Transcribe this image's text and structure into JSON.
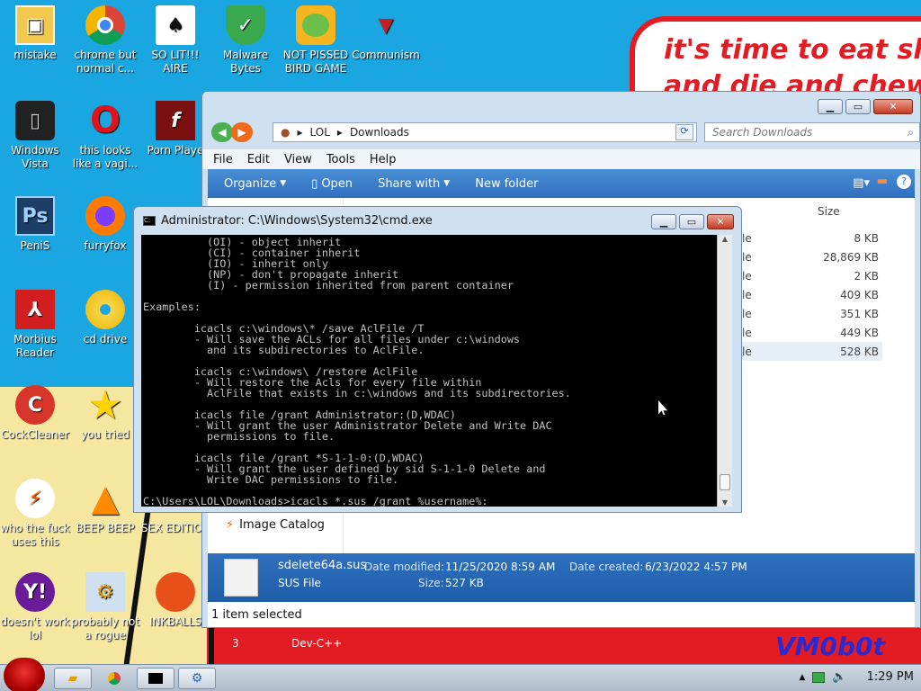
{
  "wallpaper": {
    "bubble_line1": "it's time to eat shit",
    "bubble_line2": "and die and chew",
    "signature": "VM0b0t"
  },
  "desktop_icons": [
    {
      "label": "mistake",
      "icon": "photo-frame-icon"
    },
    {
      "label": "chrome but normal c...",
      "icon": "chrome-icon"
    },
    {
      "label": "SO LIT!!! AIRE",
      "icon": "solitaire-icon"
    },
    {
      "label": "Malware Bytes",
      "icon": "shield-check-icon"
    },
    {
      "label": "NOT PISSED BIRD GAME",
      "icon": "green-pig-icon"
    },
    {
      "label": "Communism",
      "icon": "emblem-icon"
    },
    {
      "label": "Windows Vista",
      "icon": "recycle-bin-icon"
    },
    {
      "label": "this looks like a vagi...",
      "icon": "opera-icon"
    },
    {
      "label": "Porn Playe",
      "icon": "flash-icon"
    },
    {
      "label": "PeniS",
      "icon": "photoshop-icon"
    },
    {
      "label": "furryfox",
      "icon": "firefox-icon"
    },
    {
      "label": "Morbius Reader",
      "icon": "pdf-reader-icon"
    },
    {
      "label": "cd drive",
      "icon": "cd-drive-icon"
    },
    {
      "label": "CockCleaner",
      "icon": "ccleaner-icon"
    },
    {
      "label": "you tried",
      "icon": "star-icon"
    },
    {
      "label": "who the fuck uses this",
      "icon": "lightning-icon"
    },
    {
      "label": "BEEP BEEP",
      "icon": "vlc-cone-icon"
    },
    {
      "label": "SEX EDITIOR",
      "icon": "paint-icon"
    },
    {
      "label": "doesn't work lol",
      "icon": "yahoo-icon"
    },
    {
      "label": "probably not a rogue",
      "icon": "settings-monitor-icon"
    },
    {
      "label": "INKBALLS",
      "icon": "inkball-icon"
    }
  ],
  "partial_labels": {
    "behind_left": "3",
    "behind_right": "Dev-C++"
  },
  "explorer": {
    "breadcrumb": [
      "LOL",
      "Downloads"
    ],
    "search_placeholder": "Search Downloads",
    "menu": [
      "File",
      "Edit",
      "View",
      "Tools",
      "Help"
    ],
    "commands": [
      "Organize",
      "Open",
      "Share with",
      "New folder"
    ],
    "column_size": "Size",
    "rows": [
      {
        "type": "le",
        "size": "8 KB"
      },
      {
        "type": "le",
        "size": "28,869 KB"
      },
      {
        "type": "le",
        "size": "2 KB"
      },
      {
        "type": "le",
        "size": "409 KB"
      },
      {
        "type": "le",
        "size": "351 KB"
      },
      {
        "type": "le",
        "size": "449 KB"
      },
      {
        "type": "le",
        "size": "528 KB"
      }
    ],
    "sidebar_item": "Image Catalog",
    "details": {
      "filename": "sdelete64a.sus",
      "filetype": "SUS File",
      "modified_label": "Date modified:",
      "modified_value": "11/25/2020 8:59 AM",
      "created_label": "Date created:",
      "created_value": "6/23/2022 4:57 PM",
      "size_label": "Size:",
      "size_value": "527 KB"
    },
    "status": "1 item selected"
  },
  "cmd": {
    "title": "Administrator: C:\\Windows\\System32\\cmd.exe",
    "lines": [
      "          (OI) - object inherit",
      "          (CI) - container inherit",
      "          (IO) - inherit only",
      "          (NP) - don't propagate inherit",
      "          (I) - permission inherited from parent container",
      "",
      "Examples:",
      "",
      "        icacls c:\\windows\\* /save AclFile /T",
      "        - Will save the ACLs for all files under c:\\windows",
      "          and its subdirectories to AclFile.",
      "",
      "        icacls c:\\windows\\ /restore AclFile",
      "        - Will restore the Acls for every file within",
      "          AclFile that exists in c:\\windows and its subdirectories.",
      "",
      "        icacls file /grant Administrator:(D,WDAC)",
      "        - Will grant the user Administrator Delete and Write DAC",
      "          permissions to file.",
      "",
      "        icacls file /grant *S-1-1-0:(D,WDAC)",
      "        - Will grant the user defined by sid S-1-1-0 Delete and",
      "          Write DAC permissions to file.",
      "",
      "C:\\Users\\LOL\\Downloads>icacls *.sus /grant %username%:"
    ]
  },
  "taskbar": {
    "clock": "1:29 PM"
  }
}
